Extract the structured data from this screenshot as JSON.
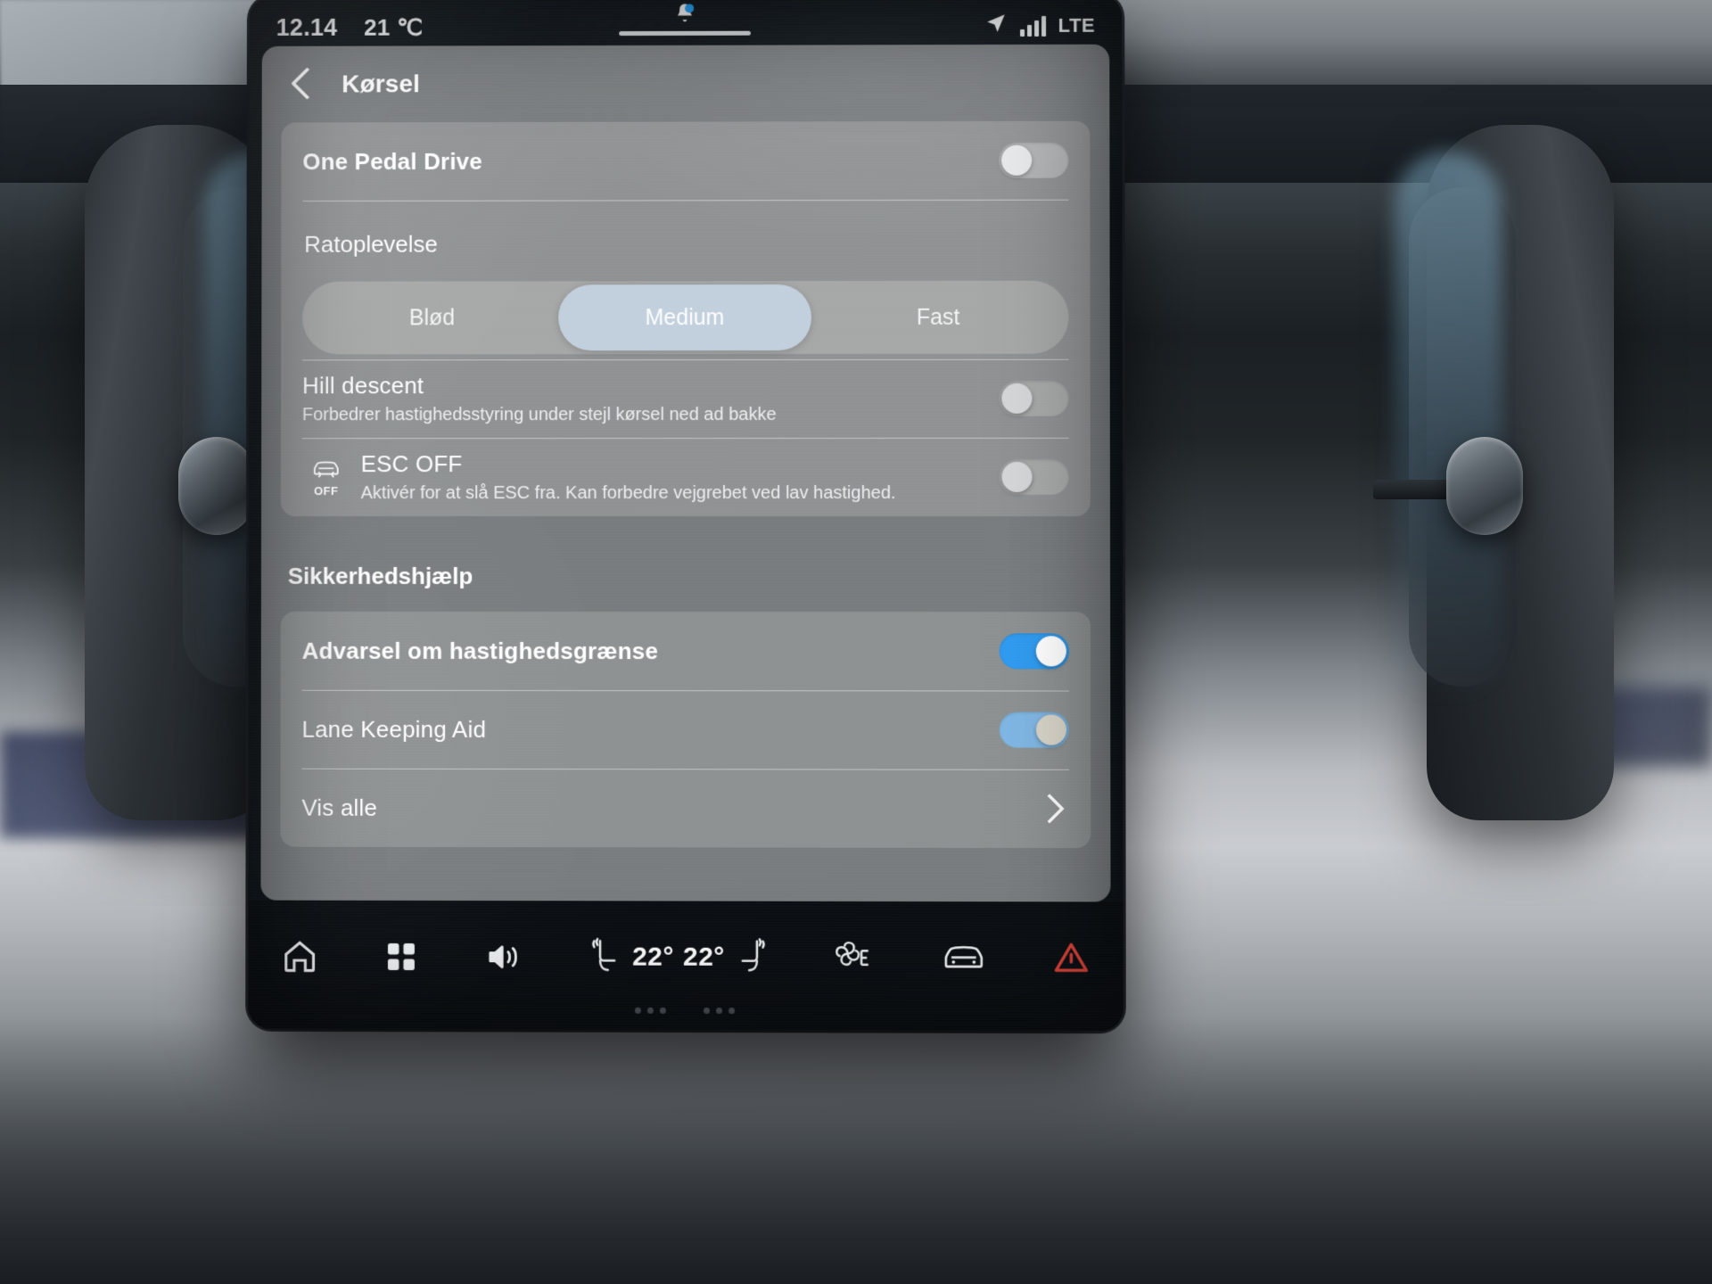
{
  "statusbar": {
    "clock": "12.14",
    "temperature": "21 ℃",
    "notification_icon": "bell-icon",
    "signal_icon": "signal-bars-icon",
    "location_icon": "navigation-arrow-icon",
    "network": "LTE"
  },
  "header": {
    "back_icon": "chevron-left-icon",
    "title": "Kørsel"
  },
  "drive_card": {
    "one_pedal_drive": {
      "label": "One Pedal Drive",
      "state": "off"
    },
    "steering_feel": {
      "label": "Ratoplevelse",
      "options": [
        "Blød",
        "Medium",
        "Fast"
      ],
      "selected": "Medium"
    },
    "hill_descent": {
      "label": "Hill descent",
      "description": "Forbedrer hastighedsstyring under stejl kørsel ned ad bakke",
      "state": "off"
    },
    "esc_off": {
      "icon": "esc-off-car-icon",
      "icon_label": "OFF",
      "label": "ESC OFF",
      "description": "Aktivér for at slå ESC fra. Kan forbedre vejgrebet ved lav hastighed.",
      "state": "off"
    }
  },
  "safety_section": {
    "heading": "Sikkerhedshjælp",
    "rows": [
      {
        "label": "Advarsel om hastighedsgrænse",
        "state": "on"
      },
      {
        "label": "Lane Keeping Aid",
        "state": "on-pending"
      }
    ],
    "show_all": {
      "label": "Vis alle",
      "chevron_icon": "chevron-right-icon"
    }
  },
  "navbar": {
    "home_icon": "home-icon",
    "apps_icon": "apps-grid-icon",
    "volume_icon": "speaker-icon",
    "seat_left_icon": "seat-heater-left-icon",
    "temp_left": "22°",
    "temp_right": "22°",
    "seat_right_icon": "seat-heater-right-icon",
    "climate_icon": "climate-fan-icon",
    "car_icon": "car-settings-icon",
    "hazard_icon": "hazard-triangle-icon"
  },
  "colors": {
    "accent_blue": "#2f9bf0",
    "accent_blue_soft": "#7fb7e4",
    "hazard_red": "#e2443a",
    "panel": "#9ea0a0",
    "screen_bg": "#0e1419"
  }
}
